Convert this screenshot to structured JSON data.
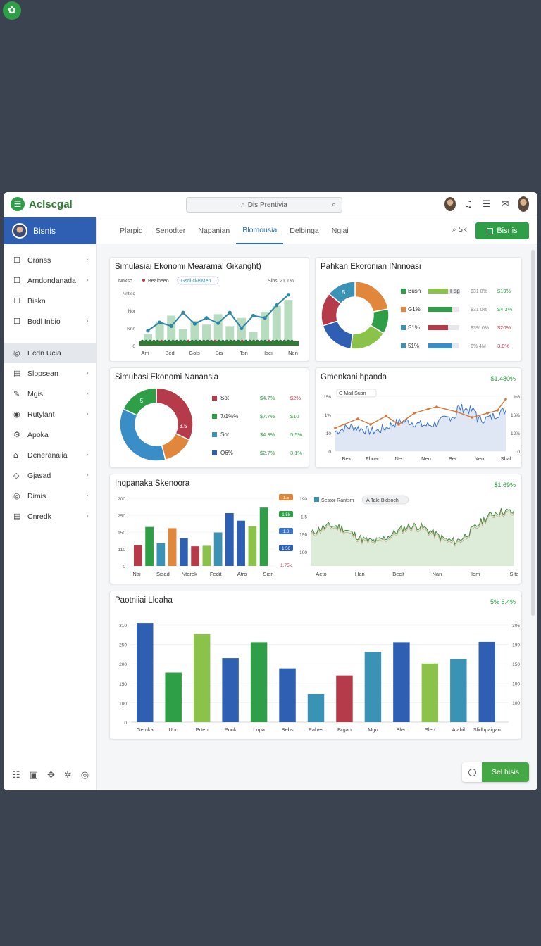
{
  "app": {
    "corner_icon": "leaf-icon",
    "brand": "Aclscgal"
  },
  "search": {
    "placeholder": "Dis Prentivia"
  },
  "sidebar": {
    "header": "Bisnis",
    "items": [
      {
        "label": "Cranss",
        "icon": "square-icon",
        "chev": true
      },
      {
        "label": "Arndondanada",
        "icon": "square-icon",
        "chev": true
      },
      {
        "label": "Biskn",
        "icon": "square-icon",
        "chev": false
      },
      {
        "label": "Bodl Inbio",
        "icon": "square-icon",
        "chev": true
      },
      {
        "label": "Ecdn Ucia",
        "icon": "circle-icon",
        "chev": false,
        "active": true
      },
      {
        "label": "Slopsean",
        "icon": "folder-icon",
        "chev": true
      },
      {
        "label": "Mgis",
        "icon": "edit-icon",
        "chev": true
      },
      {
        "label": "Rutylant",
        "icon": "eye-icon",
        "chev": true
      },
      {
        "label": "Apoka",
        "icon": "gear-icon",
        "chev": false
      },
      {
        "label": "Deneranaiia",
        "icon": "lock-icon",
        "chev": true
      },
      {
        "label": "Gjasad",
        "icon": "pin-icon",
        "chev": true
      },
      {
        "label": "Dimis",
        "icon": "target-icon",
        "chev": true
      },
      {
        "label": "Cnredk",
        "icon": "list-icon",
        "chev": true
      }
    ]
  },
  "tabs": [
    "Plarpid",
    "Senodter",
    "Napanian",
    "Blomousia",
    "Delbinga",
    "Ngiai"
  ],
  "active_tab": 3,
  "tab_search": "Sk",
  "primary_button": "Bisnis",
  "fab_label": "Sel hisis",
  "colors": {
    "green": "#2e9e47",
    "blue": "#2f5fb3",
    "teal": "#3a93b5",
    "red": "#b53a4a",
    "orange": "#e0873c",
    "lime": "#8bc34a"
  },
  "cards": {
    "c1": {
      "title": "Simulasiai Ekonomi Mearamal Gikanght)",
      "legend_a": "Nnkso",
      "legend_b": "Bealbeeo",
      "legend_c": "Gsrli ckelMen",
      "tag": "Slbsi 21.1%"
    },
    "c2": {
      "title": "Pahkan Ekoronian INnnoasi",
      "center_label": "5",
      "rows": [
        {
          "a": "Bush",
          "b": "Fag",
          "c": "$31 0%",
          "d": "$19%"
        },
        {
          "a": "G1%",
          "b": "",
          "c": "$31 0%",
          "d": "$4.3%"
        },
        {
          "a": "S1%",
          "b": "",
          "c": "$3% 0%",
          "d": "$20%"
        },
        {
          "a": "51%",
          "b": "",
          "c": "$% 4M",
          "d": "3.0%"
        }
      ]
    },
    "c3": {
      "title": "Simubasi Ekonomi Nanansia",
      "center_label": "5",
      "slice_label": "3.5",
      "rows": [
        {
          "a": "Sot",
          "b": "$4.7%",
          "c": "$2%"
        },
        {
          "a": "7/1%%",
          "b": "$7.7%",
          "c": "$10"
        },
        {
          "a": "Sot",
          "b": "$4.3%",
          "c": "5.5%"
        },
        {
          "a": "O6%",
          "b": "$2.7%",
          "c": "3.1%"
        }
      ]
    },
    "c4": {
      "title": "Gmenkani hpanda",
      "tag": "$1.480%",
      "legend": "O Mail Suan"
    },
    "c5": {
      "title": "Inqpanaka Skenoora",
      "tag": "$1.69%",
      "badges": [
        "1.5",
        "1.5k",
        "1.8",
        "1.56",
        "1.75k"
      ],
      "legend_a": "Sestor Rantsm",
      "legend_b": "A Tale Bidsoch"
    },
    "c6": {
      "title": "Paotniiai Lloaha",
      "tag": "5% 6.4%"
    }
  },
  "chart_data": [
    {
      "type": "bar",
      "name_ref": "c1",
      "categories": [
        "Am",
        "Bed",
        "Gols",
        "Bis",
        "Tsn",
        "Isei",
        "Nen"
      ],
      "series": [
        {
          "values": [
            15,
            31,
            40,
            22,
            33,
            28,
            42,
            26,
            37,
            18,
            45,
            53,
            61
          ],
          "kind": "bar"
        },
        {
          "values": [
            20,
            31,
            26,
            44,
            29,
            37,
            30,
            44,
            23,
            40,
            37,
            54,
            68
          ],
          "kind": "line"
        }
      ],
      "yticks": [
        "Nntiso",
        "Nor",
        "Nnn",
        "0"
      ],
      "ylim": [
        0,
        80
      ]
    },
    {
      "type": "pie",
      "name_ref": "c2",
      "values": [
        22,
        12,
        18,
        18,
        16,
        14
      ],
      "colors": [
        "#e0873c",
        "#2e9e47",
        "#8bc34a",
        "#2f5fb3",
        "#b53a4a",
        "#3a93b5"
      ]
    },
    {
      "type": "pie",
      "name_ref": "c3",
      "values": [
        32,
        14,
        36,
        18
      ],
      "colors": [
        "#b53a4a",
        "#e0873c",
        "#3a8ec8",
        "#2e9e47"
      ]
    },
    {
      "type": "line",
      "name_ref": "c4",
      "categories": [
        "Bek",
        "Fhoad",
        "Ned",
        "Nen",
        "Ber",
        "Nen",
        "Sbal"
      ],
      "yticks_left": [
        "156",
        "1%",
        "10",
        "0"
      ],
      "yticks_right": [
        "%6",
        "16%",
        "12%",
        "0"
      ],
      "ylim": [
        0,
        100
      ]
    },
    {
      "type": "bar",
      "name_ref": "c5-left",
      "categories": [
        "Nai",
        "Sisad",
        "Ntarek",
        "Fedit",
        "Atro",
        "Sien"
      ],
      "values": [
        82,
        155,
        90,
        150,
        110,
        78,
        80,
        133,
        210,
        180,
        158,
        232
      ],
      "colors": [
        "#b53a4a",
        "#2e9e47",
        "#3a93b5",
        "#e0873c",
        "#2f5fb3",
        "#b53a4a",
        "#8bc34a",
        "#3a93b5",
        "#2f5fb3",
        "#2f5fb3",
        "#8bc34a",
        "#2e9e47"
      ],
      "yticks": [
        "200",
        "250",
        "150",
        "110",
        "0"
      ],
      "ylim": [
        0,
        280
      ]
    },
    {
      "type": "area",
      "name_ref": "c5-right",
      "categories": [
        "Aeto",
        "Han",
        "Beclt",
        "Nan",
        "Iom",
        "Slte"
      ],
      "yticks": [
        "190",
        "1.5",
        "196",
        "100"
      ],
      "ylim": [
        0,
        200
      ]
    },
    {
      "type": "bar",
      "name_ref": "c6",
      "categories": [
        "Gemka",
        "Uun",
        "Prten",
        "Ponk",
        "Lnpa",
        "Bebs",
        "Pahes",
        "Brgan",
        "Mgn",
        "Bleo",
        "Slen",
        "Alabil",
        "Slidbpaigan"
      ],
      "values": [
        310,
        155,
        275,
        200,
        250,
        168,
        88,
        146,
        219,
        250,
        183,
        198,
        251
      ],
      "colors": [
        "#2f5fb3",
        "#2e9e47",
        "#8bc34a",
        "#2f5fb3",
        "#2e9e47",
        "#2f5fb3",
        "#3a93b5",
        "#b53a4a",
        "#3a93b5",
        "#2f5fb3",
        "#8bc34a",
        "#3a93b5",
        "#2f5fb3"
      ],
      "yticks_left": [
        "310",
        "250",
        "200",
        "150",
        "100",
        "0"
      ],
      "yticks_right": [
        "306",
        "199",
        "150",
        "100",
        "100"
      ],
      "ylim": [
        0,
        330
      ]
    }
  ]
}
